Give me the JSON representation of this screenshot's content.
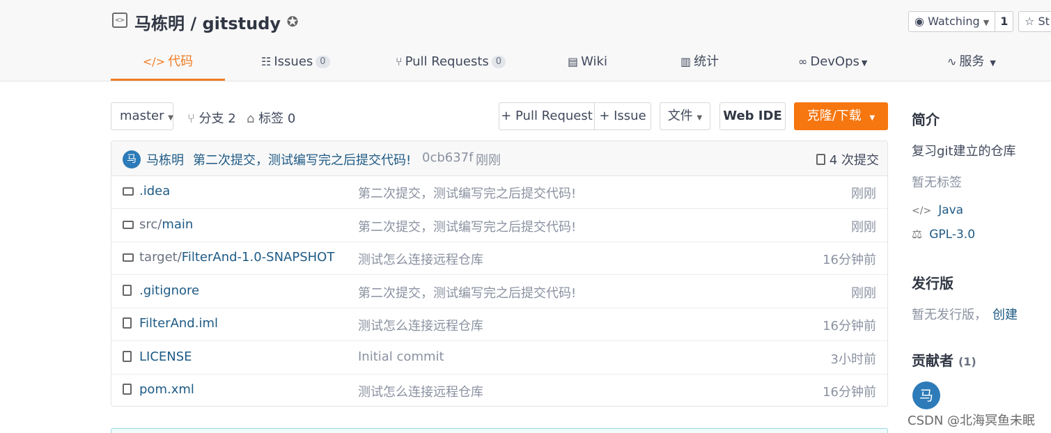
{
  "repo": {
    "owner": "马栋明",
    "separator": " / ",
    "name": "gitstudy"
  },
  "watch": {
    "label": "Watching",
    "count": "1"
  },
  "star": {
    "label": "St"
  },
  "tabs": [
    {
      "icon": "</>",
      "label": "代码"
    },
    {
      "label": "Issues",
      "count": "0"
    },
    {
      "label": "Pull Requests",
      "count": "0"
    },
    {
      "label": "Wiki"
    },
    {
      "label": "统计"
    },
    {
      "label": "DevOps"
    },
    {
      "label": "服务"
    }
  ],
  "toolbar": {
    "branch": "master",
    "branches": "分支 2",
    "tags": "标签 0",
    "pull_request": "+ Pull Request",
    "issue": "+ Issue",
    "file": "文件",
    "web_ide": "Web IDE",
    "clone": "克隆/下载"
  },
  "commit": {
    "avatar": "马",
    "author": "马栋明",
    "message": "第二次提交，测试编写完之后提交代码!",
    "hash": "0cb637f",
    "time": "刚刚",
    "count": "4 次提交"
  },
  "files": [
    {
      "type": "folder",
      "prefix": "",
      "name": ".idea",
      "message": "第二次提交，测试编写完之后提交代码!",
      "time": "刚刚"
    },
    {
      "type": "folder",
      "prefix": "src/",
      "name": "main",
      "message": "第二次提交，测试编写完之后提交代码!",
      "time": "刚刚"
    },
    {
      "type": "folder",
      "prefix": "target/",
      "name": "FilterAnd-1.0-SNAPSHOT",
      "message": "测试怎么连接远程仓库",
      "time": "16分钟前"
    },
    {
      "type": "file",
      "prefix": "",
      "name": ".gitignore",
      "message": "第二次提交，测试编写完之后提交代码!",
      "time": "刚刚"
    },
    {
      "type": "file",
      "prefix": "",
      "name": "FilterAnd.iml",
      "message": "测试怎么连接远程仓库",
      "time": "16分钟前"
    },
    {
      "type": "file",
      "prefix": "",
      "name": "LICENSE",
      "message": "Initial commit",
      "time": "3小时前"
    },
    {
      "type": "file",
      "prefix": "",
      "name": "pom.xml",
      "message": "测试怎么连接远程仓库",
      "time": "16分钟前"
    }
  ],
  "sidebar": {
    "intro_title": "简介",
    "intro_text": "复习git建立的仓库",
    "no_tags": "暂无标签",
    "language": "Java",
    "license": "GPL-3.0",
    "release_title": "发行版",
    "no_release": "暂无发行版，",
    "create": "创建",
    "contributors_title": "贡献者",
    "contributors_count": "(1)",
    "contributor_avatar": "马"
  },
  "watermark": "CSDN @北海冥鱼未眠"
}
